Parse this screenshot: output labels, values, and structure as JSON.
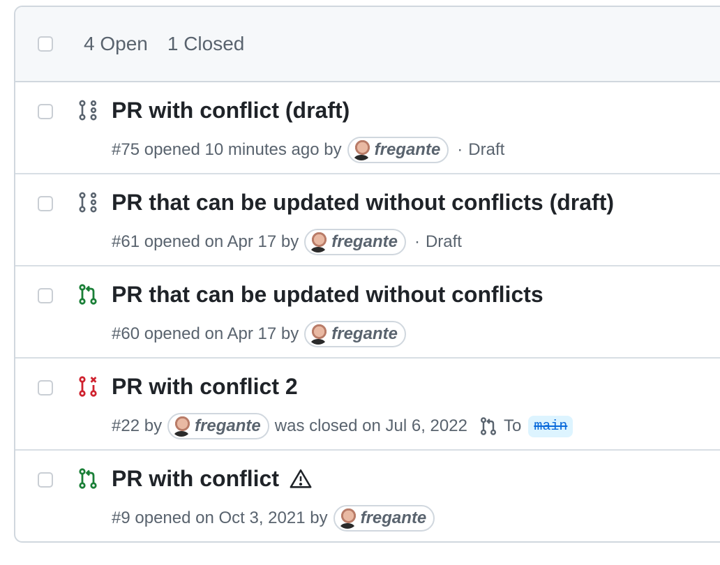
{
  "header": {
    "open_label": "4 Open",
    "closed_label": "1 Closed"
  },
  "colors": {
    "open_green": "#1a7f37",
    "closed_red": "#cf222e",
    "draft_gray": "#59636e",
    "branch_blue": "#0969da"
  },
  "pull_requests": [
    {
      "title": "PR with conflict (draft)",
      "number": "#75",
      "status_text": "opened 10 minutes ago by",
      "author": "fregante",
      "draft_label": "Draft",
      "state_icon": "git-pull-request-draft-icon"
    },
    {
      "title": "PR that can be updated without conflicts (draft)",
      "number": "#61",
      "status_text": "opened on Apr 17 by",
      "author": "fregante",
      "draft_label": "Draft",
      "state_icon": "git-pull-request-draft-icon"
    },
    {
      "title": "PR that can be updated without conflicts",
      "number": "#60",
      "status_text": "opened on Apr 17 by",
      "author": "fregante",
      "state_icon": "git-pull-request-icon"
    },
    {
      "title": "PR with conflict 2",
      "number": "#22",
      "by_text": "by",
      "author": "fregante",
      "closed_text": "was closed on Jul 6, 2022",
      "to_label": "To",
      "branch": "main",
      "state_icon": "git-pull-request-closed-icon"
    },
    {
      "title": "PR with conflict",
      "number": "#9",
      "status_text": "opened on Oct 3, 2021 by",
      "author": "fregante",
      "state_icon": "git-pull-request-icon",
      "extra_icon": "alert-icon"
    }
  ]
}
